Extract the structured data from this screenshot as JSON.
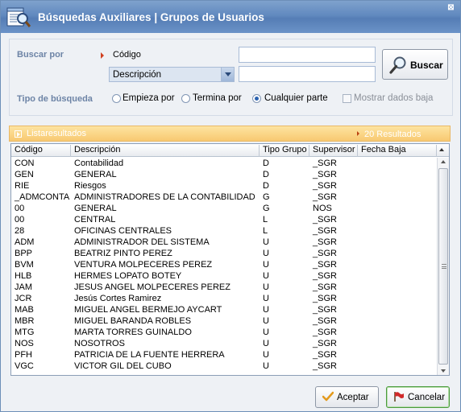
{
  "window": {
    "title_left": "Búsquedas Auxiliares",
    "title_sep": "|",
    "title_right": "Grupos de Usuarios",
    "close_glyph": "⊠"
  },
  "search": {
    "buscar_por_label": "Buscar por",
    "codigo_label": "Código",
    "combo_value": "Descripción",
    "input_codigo_value": "",
    "input_descripcion_value": "",
    "buscar_button": "Buscar",
    "tipo_label": "Tipo de búsqueda",
    "options": [
      {
        "label": "Empieza por",
        "selected": false
      },
      {
        "label": "Termina por",
        "selected": false
      },
      {
        "label": "Cualquier parte",
        "selected": true
      }
    ],
    "mostrar_baja_label": "Mostrar dados baja",
    "mostrar_baja_checked": false
  },
  "results": {
    "title": "Listaresultados",
    "count_text": "20 Resultados"
  },
  "grid": {
    "columns": [
      "Código",
      "Descripción",
      "Tipo Grupo",
      "Supervisor",
      "Fecha Baja"
    ],
    "rows": [
      [
        "CON",
        "Contabilidad",
        "D",
        "_SGR",
        ""
      ],
      [
        "GEN",
        "GENERAL",
        "D",
        "_SGR",
        ""
      ],
      [
        "RIE",
        "Riesgos",
        "D",
        "_SGR",
        ""
      ],
      [
        "_ADMCONTA",
        "ADMINISTRADORES DE LA CONTABILIDAD",
        "G",
        "_SGR",
        ""
      ],
      [
        "00",
        "GENERAL",
        "G",
        "NOS",
        ""
      ],
      [
        "00",
        "CENTRAL",
        "L",
        "_SGR",
        ""
      ],
      [
        "28",
        "OFICINAS CENTRALES",
        "L",
        "_SGR",
        ""
      ],
      [
        "ADM",
        "ADMINISTRADOR DEL SISTEMA",
        "U",
        "_SGR",
        ""
      ],
      [
        "BPP",
        "BEATRIZ PINTO PEREZ",
        "U",
        "_SGR",
        ""
      ],
      [
        "BVM",
        "VENTURA MOLPECERES PEREZ",
        "U",
        "_SGR",
        ""
      ],
      [
        "HLB",
        "HERMES LOPATO BOTEY",
        "U",
        "_SGR",
        ""
      ],
      [
        "JAM",
        "JESUS ANGEL MOLPECERES PEREZ",
        "U",
        "_SGR",
        ""
      ],
      [
        "JCR",
        "Jesús Cortes Ramirez",
        "U",
        "_SGR",
        ""
      ],
      [
        "MAB",
        "MIGUEL ANGEL BERMEJO AYCART",
        "U",
        "_SGR",
        ""
      ],
      [
        "MBR",
        "MIGUEL BARANDA ROBLES",
        "U",
        "_SGR",
        ""
      ],
      [
        "MTG",
        "MARTA TORRES GUINALDO",
        "U",
        "_SGR",
        ""
      ],
      [
        "NOS",
        "NOSOTROS",
        "U",
        "_SGR",
        ""
      ],
      [
        "PFH",
        "PATRICIA DE LA FUENTE HERRERA",
        "U",
        "_SGR",
        ""
      ],
      [
        "VGC",
        "VICTOR GIL DEL CUBO",
        "U",
        "_SGR",
        ""
      ]
    ]
  },
  "footer": {
    "aceptar": "Aceptar",
    "cancelar": "Cancelar"
  },
  "colors": {
    "title_bar": "#6189bf",
    "label_blue": "#6d84a6",
    "results_bar": "#f8c971",
    "accent_green": "#4a9a3c"
  }
}
